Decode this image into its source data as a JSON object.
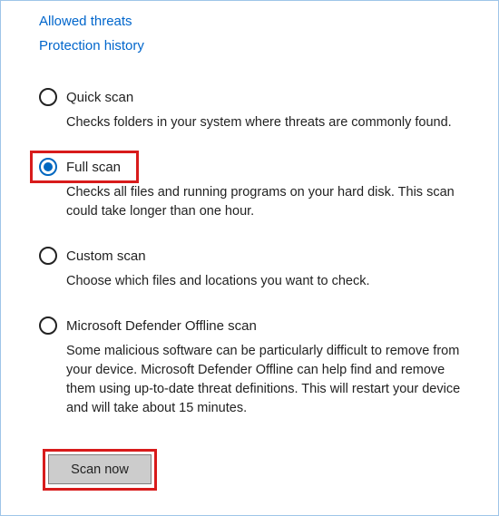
{
  "links": {
    "allowed_threats": "Allowed threats",
    "protection_history": "Protection history"
  },
  "options": {
    "quick": {
      "label": "Quick scan",
      "desc": "Checks folders in your system where threats are commonly found."
    },
    "full": {
      "label": "Full scan",
      "desc": "Checks all files and running programs on your hard disk. This scan could take longer than one hour."
    },
    "custom": {
      "label": "Custom scan",
      "desc": "Choose which files and locations you want to check."
    },
    "offline": {
      "label": "Microsoft Defender Offline scan",
      "desc": "Some malicious software can be particularly difficult to remove from your device. Microsoft Defender Offline can help find and remove them using up-to-date threat definitions. This will restart your device and will take about 15 minutes."
    }
  },
  "buttons": {
    "scan_now": "Scan now"
  },
  "selected_option": "full"
}
